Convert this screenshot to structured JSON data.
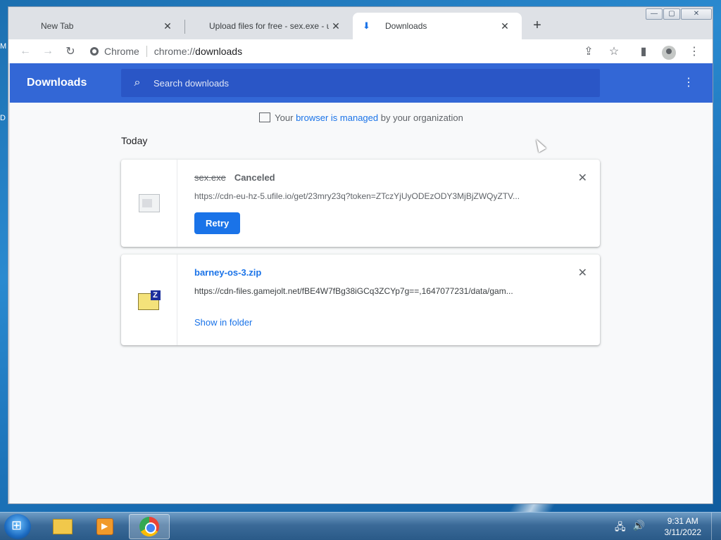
{
  "desktop": {
    "edge_labels": [
      "M",
      "D"
    ]
  },
  "tabs": [
    {
      "title": "New Tab",
      "close": "✕",
      "active": false
    },
    {
      "title": "Upload files for free - sex.exe - uf",
      "close": "✕",
      "active": false
    },
    {
      "title": "Downloads",
      "close": "✕",
      "active": true
    }
  ],
  "new_tab": "+",
  "window_controls": {
    "minimize": "—",
    "maximize": "▢",
    "close": "✕"
  },
  "toolbar": {
    "back": "←",
    "forward": "→",
    "reload": "↻",
    "site_chip": "Chrome",
    "url_scheme": "chrome://",
    "url_path": "downloads",
    "share": "⇪",
    "bookmark": "☆",
    "side_panel": "▮",
    "menu": "⋮"
  },
  "downloads": {
    "title": "Downloads",
    "search_placeholder": "Search downloads",
    "more": "⋮",
    "managed_prefix": "Your ",
    "managed_link": "browser is managed",
    "managed_suffix": " by your organization",
    "section": "Today",
    "items": [
      {
        "filename": "sex.exe",
        "status": "Canceled",
        "url": "https://cdn-eu-hz-5.ufile.io/get/23mry23q?token=ZTczYjUyODEzODY3MjBjZWQyZTV...",
        "action": "Retry",
        "remove": "✕"
      },
      {
        "filename": "barney-os-3.zip",
        "url": "https://cdn-files.gamejolt.net/fBE4W7fBg38iGCq3ZCYp7g==,1647077231/data/gam...",
        "action": "Show in folder",
        "remove": "✕"
      }
    ]
  },
  "taskbar": {
    "time": "9:31 AM",
    "date": "3/11/2022",
    "tray_network": "🖧",
    "tray_volume": "🔊"
  }
}
